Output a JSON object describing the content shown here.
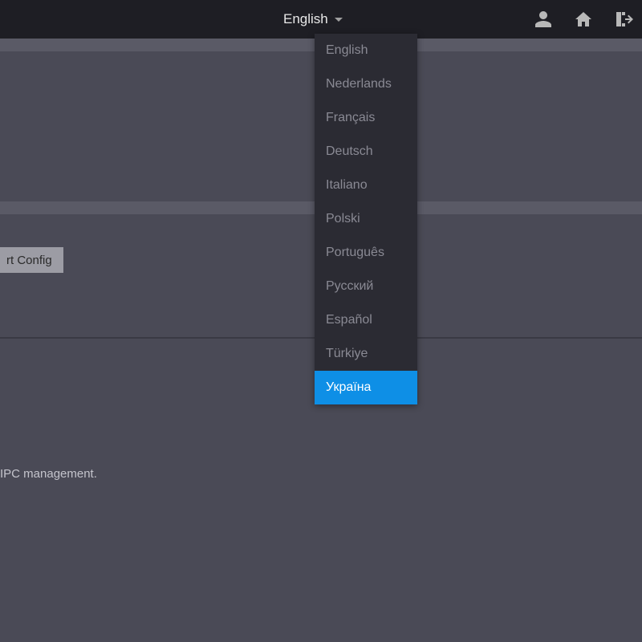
{
  "topbar": {
    "language_current": "English",
    "icons": {
      "user": "user-icon",
      "home": "home-icon",
      "logout": "logout-icon"
    }
  },
  "language_dropdown": {
    "items": [
      {
        "label": "English",
        "selected": false
      },
      {
        "label": "Nederlands",
        "selected": false
      },
      {
        "label": "Français",
        "selected": false
      },
      {
        "label": "Deutsch",
        "selected": false
      },
      {
        "label": "Italiano",
        "selected": false
      },
      {
        "label": "Polski",
        "selected": false
      },
      {
        "label": "Português",
        "selected": false
      },
      {
        "label": "Русский",
        "selected": false
      },
      {
        "label": "Español",
        "selected": false
      },
      {
        "label": "Türkiye",
        "selected": false
      },
      {
        "label": "Україна",
        "selected": true
      }
    ]
  },
  "button": {
    "config_label": "rt Config"
  },
  "footer": {
    "text": "IPC management."
  },
  "colors": {
    "accent": "#0e8fe6",
    "bg": "#4a4a56",
    "dropdown_bg": "#2b2b33",
    "topbar_bg": "#1e1e24"
  }
}
